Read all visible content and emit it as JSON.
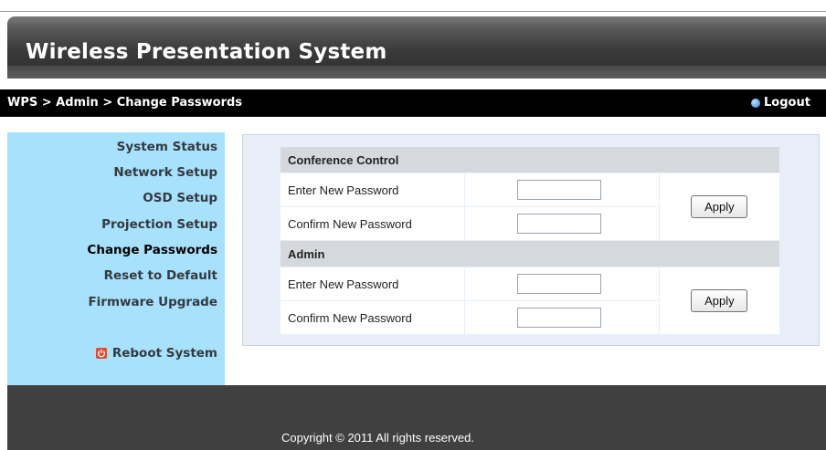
{
  "header": {
    "title": "Wireless Presentation System"
  },
  "breadcrumb": {
    "text": "WPS > Admin > Change Passwords"
  },
  "logout": {
    "label": "Logout"
  },
  "sidebar": {
    "items": [
      {
        "label": "System Status"
      },
      {
        "label": "Network Setup"
      },
      {
        "label": "OSD Setup"
      },
      {
        "label": "Projection Setup"
      },
      {
        "label": "Change Passwords",
        "active": true
      },
      {
        "label": "Reset to Default"
      },
      {
        "label": "Firmware Upgrade"
      }
    ],
    "reboot": {
      "label": "Reboot System",
      "icon": "power-icon"
    }
  },
  "form": {
    "sections": [
      {
        "title": "Conference Control",
        "fields": [
          {
            "label": "Enter New Password",
            "value": ""
          },
          {
            "label": "Confirm New Password",
            "value": ""
          }
        ],
        "apply_label": "Apply"
      },
      {
        "title": "Admin",
        "fields": [
          {
            "label": "Enter New Password",
            "value": ""
          },
          {
            "label": "Confirm New Password",
            "value": ""
          }
        ],
        "apply_label": "Apply"
      }
    ]
  },
  "footer": {
    "copyright": "Copyright © 2011 All rights reserved."
  },
  "colors": {
    "sidebar_bg": "#a8e1fb",
    "crumb_bar": "#000000",
    "footer_bg": "#404040",
    "section_header": "#d5d9de",
    "reboot_icon": "#e34a2e"
  }
}
